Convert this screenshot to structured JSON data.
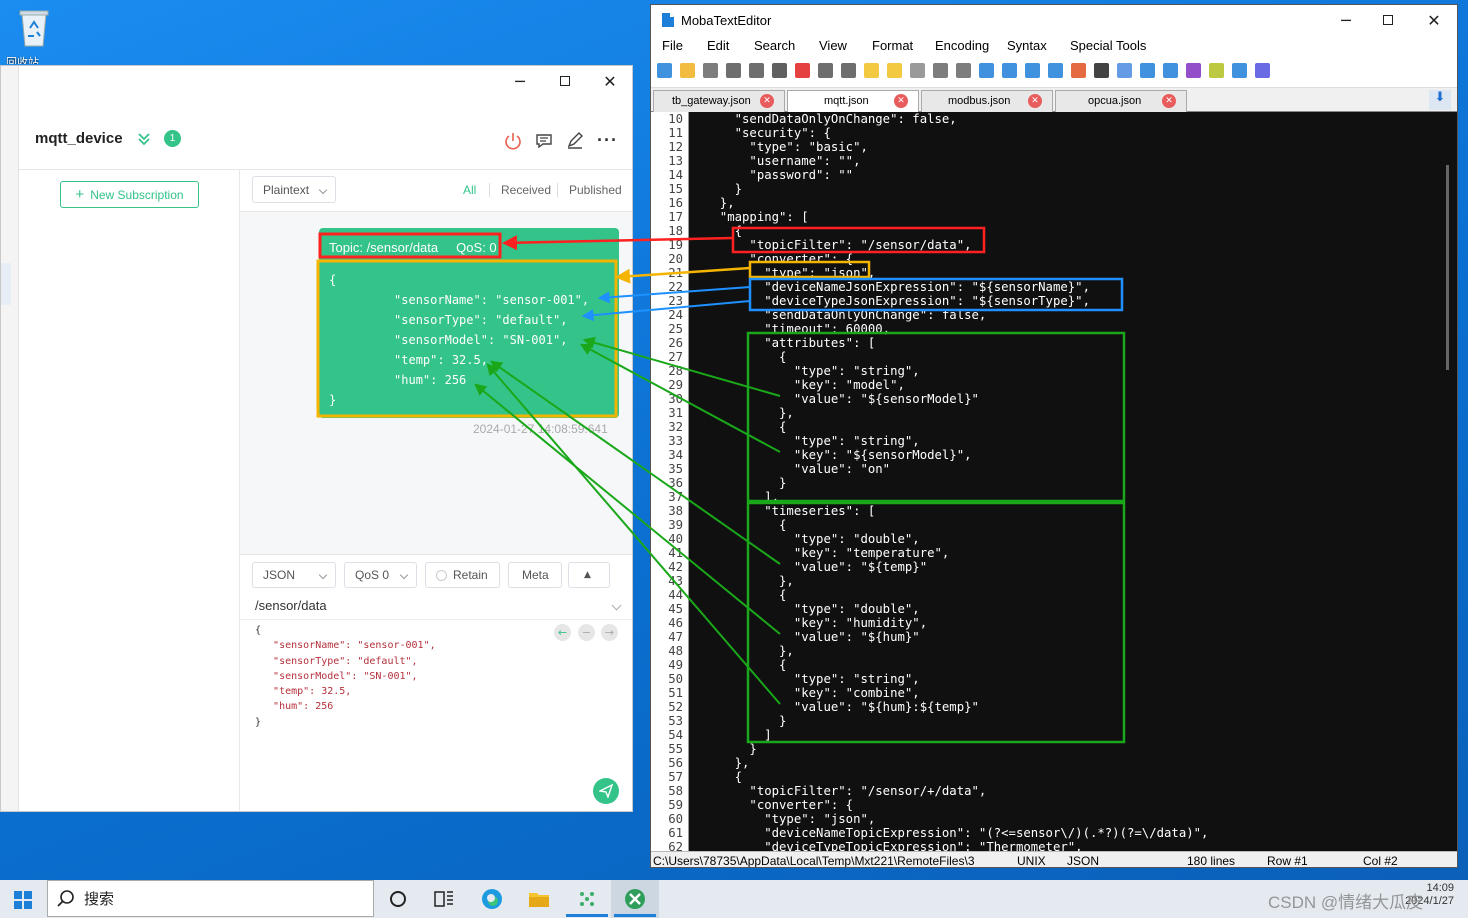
{
  "desktop": {
    "recycle_label": "回收站"
  },
  "mqttx": {
    "connection_name": "mqtt_device",
    "badge_count": "1",
    "new_subscription": "New Subscription",
    "payload_format": "Plaintext",
    "filters": [
      "All",
      "Received",
      "Published"
    ],
    "message": {
      "topic_line": "Topic: /sensor/data     QoS: 0",
      "body_lines": [
        "{",
        "         \"sensorName\": \"sensor-001\",",
        "         \"sensorType\": \"default\",",
        "         \"sensorModel\": \"SN-001\",",
        "         \"temp\": 32.5,",
        "         \"hum\": 256",
        "}"
      ],
      "timestamp": "2024-01-27 14:08:59:641"
    },
    "publish": {
      "format": "JSON",
      "qos": "QoS 0",
      "retain": "Retain",
      "meta": "Meta",
      "topic": "/sensor/data",
      "body_lines": [
        "{",
        "   \"sensorName\": \"sensor-001\",",
        "   \"sensorType\": \"default\",",
        "   \"sensorModel\": \"SN-001\",",
        "   \"temp\": 32.5,",
        "   \"hum\": 256",
        "}"
      ]
    }
  },
  "editor": {
    "title": "MobaTextEditor",
    "menu": [
      "File",
      "Edit",
      "Search",
      "View",
      "Format",
      "Encoding",
      "Syntax",
      "Special Tools"
    ],
    "tabs": [
      "tb_gateway.json",
      "mqtt.json",
      "modbus.json",
      "opcua.json"
    ],
    "active_tab": "mqtt.json",
    "first_line_number": 10,
    "lines": [
      "    \"sendDataOnlyOnChange\": false,",
      "    \"security\": {",
      "      \"type\": \"basic\",",
      "      \"username\": \"\",",
      "      \"password\": \"\"",
      "    }",
      "  },",
      "  \"mapping\": [",
      "    {",
      "      \"topicFilter\": \"/sensor/data\",",
      "      \"converter\": {",
      "        \"type\": \"json\",",
      "        \"deviceNameJsonExpression\": \"${sensorName}\",",
      "        \"deviceTypeJsonExpression\": \"${sensorType}\",",
      "        \"sendDataOnlyOnChange\": false,",
      "        \"timeout\": 60000,",
      "        \"attributes\": [",
      "          {",
      "            \"type\": \"string\",",
      "            \"key\": \"model\",",
      "            \"value\": \"${sensorModel}\"",
      "          },",
      "          {",
      "            \"type\": \"string\",",
      "            \"key\": \"${sensorModel}\",",
      "            \"value\": \"on\"",
      "          }",
      "        ],",
      "        \"timeseries\": [",
      "          {",
      "            \"type\": \"double\",",
      "            \"key\": \"temperature\",",
      "            \"value\": \"${temp}\"",
      "          },",
      "          {",
      "            \"type\": \"double\",",
      "            \"key\": \"humidity\",",
      "            \"value\": \"${hum}\"",
      "          },",
      "          {",
      "            \"type\": \"string\",",
      "            \"key\": \"combine\",",
      "            \"value\": \"${hum}:${temp}\"",
      "          }",
      "        ]",
      "      }",
      "    },",
      "    {",
      "      \"topicFilter\": \"/sensor/+/data\",",
      "      \"converter\": {",
      "        \"type\": \"json\",",
      "        \"deviceNameTopicExpression\": \"(?<=sensor\\/)(.*?)(?=\\/data)\",",
      "        \"deviceTypeTopicExpression\": \"Thermometer\","
    ],
    "status": {
      "path": "C:\\Users\\78735\\AppData\\Local\\Temp\\Mxt221\\RemoteFiles\\3",
      "eol": "UNIX",
      "syntax": "JSON",
      "lines": "180 lines",
      "row": "Row #1",
      "col": "Col #2"
    }
  },
  "taskbar": {
    "search_label": "搜索",
    "tray_time": "14:09",
    "tray_date": "2024/1/27",
    "watermark": "CSDN @情绪大瓜皮"
  },
  "colors": {
    "mqttx_green": "#34c388",
    "annot_red": "#ff2020",
    "annot_yellow": "#f5b400",
    "annot_blue": "#1e90ff",
    "annot_green": "#1aa81a"
  }
}
